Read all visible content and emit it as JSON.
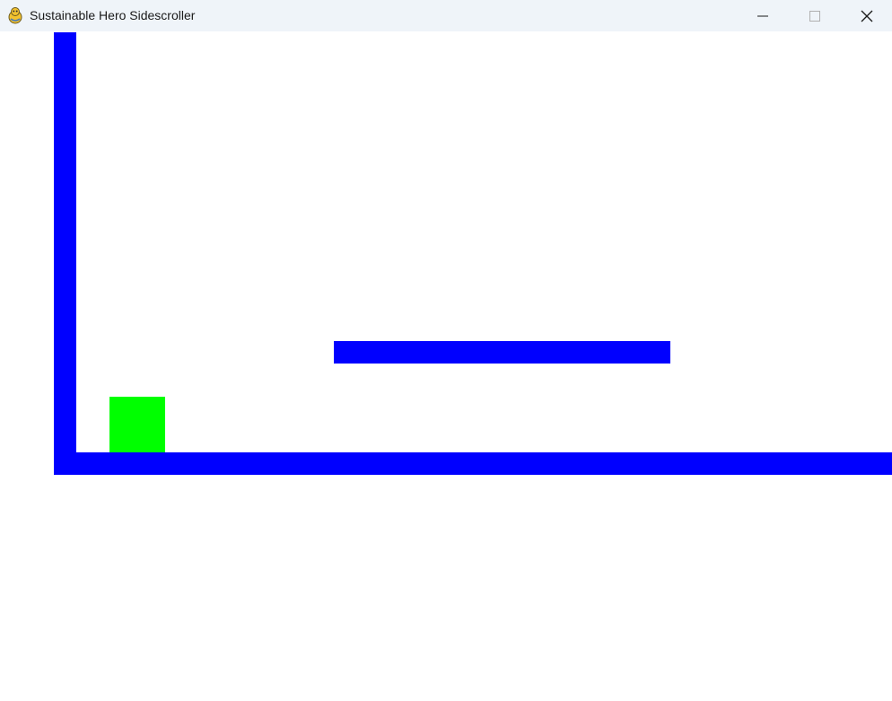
{
  "window": {
    "title": "Sustainable Hero Sidescroller",
    "icon": "pygame-snake-icon",
    "controls": {
      "minimize_icon": "minimize-icon",
      "maximize_icon": "maximize-icon",
      "close_icon": "close-icon"
    }
  },
  "game": {
    "background_color": "#ffffff",
    "objects": [
      {
        "name": "left-wall",
        "type": "wall",
        "color": "#0000ff"
      },
      {
        "name": "ground-floor",
        "type": "floor",
        "color": "#0000ff"
      },
      {
        "name": "floating-platform",
        "type": "platform",
        "color": "#0000ff"
      },
      {
        "name": "player-hero",
        "type": "player",
        "color": "#00ff00"
      }
    ]
  }
}
